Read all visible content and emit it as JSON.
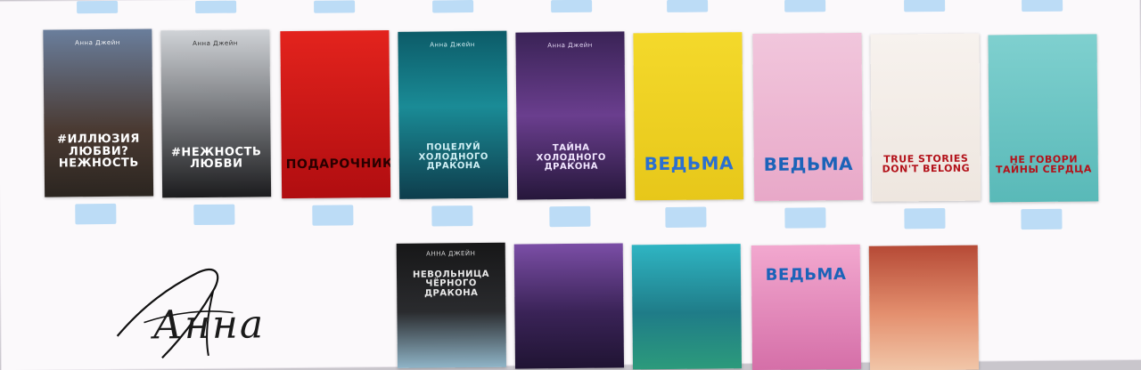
{
  "signature": {
    "text": "Анна"
  },
  "colors": {
    "background": "#fbf9fb",
    "tab": "#bcdcf6"
  },
  "row1": [
    {
      "name": "book-1",
      "author": "Анна Джейн",
      "title": "#ИЛЛЮЗИЯ ЛЮБВИ? НЕЖНОСТЬ",
      "bg": "linear-gradient(#6a7e9c,#4a3a32 60%,#2b2520)",
      "fg": "#ffffff",
      "size": "13px"
    },
    {
      "name": "book-2",
      "author": "Анна Джейн",
      "title": "#НЕЖНОСТЬ ЛЮБВИ",
      "bg": "linear-gradient(#cfd2d6,#6c6e72 55%,#1c1c1e)",
      "fg": "#ffffff",
      "size": "13px"
    },
    {
      "name": "book-3",
      "author": "",
      "title": "ПОДАРОЧНИК",
      "bg": "linear-gradient(#e3231d,#b00d10)",
      "fg": "#2a0000",
      "size": "14px"
    },
    {
      "name": "book-4",
      "author": "Анна Джейн",
      "title": "ПОЦЕЛУЙ ХОЛОДНОГО ДРАКОНА",
      "bg": "linear-gradient(#0c5b68,#1a8b96 45%,#0e3d4c)",
      "fg": "#cfeff4",
      "size": "10px"
    },
    {
      "name": "book-5",
      "author": "Анна Джейн",
      "title": "ТАЙНА ХОЛОДНОГО ДРАКОНА",
      "bg": "linear-gradient(#3a2356,#6a3e8e 50%,#26173b)",
      "fg": "#f1e6ff",
      "size": "10px"
    },
    {
      "name": "book-6",
      "author": "",
      "title": "ВЕДЬМА",
      "bg": "linear-gradient(#f4d92b,#e7c71a)",
      "fg": "#2b6fd1",
      "size": "20px"
    },
    {
      "name": "book-7",
      "author": "",
      "title": "ВЕДЬМА",
      "bg": "linear-gradient(#f1c6dc,#e8a8c8)",
      "fg": "#1b63b8",
      "size": "20px"
    },
    {
      "name": "book-8",
      "author": "",
      "title": "TRUE STORIES DON'T BELONG",
      "bg": "linear-gradient(#f7f2ee,#eee6df)",
      "fg": "#b3121a",
      "size": "11px"
    },
    {
      "name": "book-9",
      "author": "",
      "title": "НЕ ГОВОРИ ТАЙНЫ СЕРДЦА",
      "bg": "linear-gradient(#7fd0cf,#59b9b8)",
      "fg": "#b3121a",
      "size": "11px"
    }
  ],
  "row2": [
    {
      "name": "book-10",
      "author": "АННА ДЖЕЙН",
      "title": "НЕВОЛЬНИЦА ЧЁРНОГО ДРАКОНА",
      "bg": "linear-gradient(#171718,#2a2b2e 55%,#8fb4c7 100%)",
      "fg": "#e8e8e8",
      "size": "10px"
    },
    {
      "name": "book-11",
      "author": "",
      "title": "",
      "bg": "linear-gradient(#7b4ea6,#3a2357 55%,#201433)",
      "fg": "#ffffff",
      "size": "10px"
    },
    {
      "name": "book-12",
      "author": "",
      "title": "",
      "bg": "linear-gradient(#2fb5c3,#1f7c88 55%,#2c9a7b)",
      "fg": "#ffffff",
      "size": "10px"
    },
    {
      "name": "book-13",
      "author": "",
      "title": "ВЕДЬМА",
      "bg": "linear-gradient(#f2a8cf,#d56fa8)",
      "fg": "#1b63b8",
      "size": "18px"
    },
    {
      "name": "book-14",
      "author": "",
      "title": "",
      "bg": "linear-gradient(#b64a36,#e4906f 55%,#f1c6a8)",
      "fg": "#ffffff",
      "size": "10px"
    }
  ]
}
